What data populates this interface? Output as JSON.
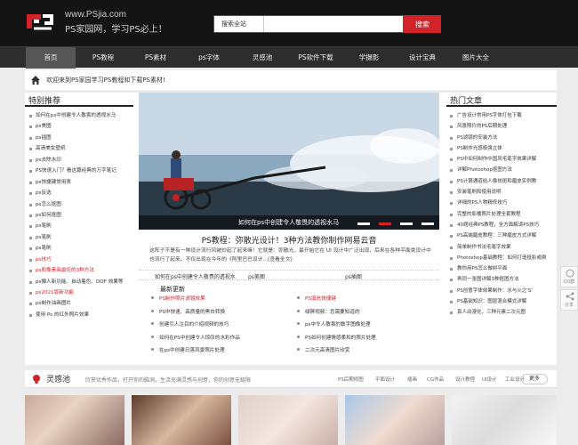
{
  "header": {
    "site_url": "www.PSjia.com",
    "slogan": "PS家园网，学习PS必上！",
    "search_select": "搜索全站",
    "search_value": "",
    "search_button": "搜索"
  },
  "nav": {
    "items": [
      "首页",
      "PS教程",
      "PS素材",
      "ps字体",
      "灵感池",
      "PS软件下载",
      "学摄影",
      "设计宝典",
      "图片大全"
    ],
    "active_index": 0
  },
  "welcome": "欢迎来到PS家园学习PS教程和下载PS素材!",
  "left": {
    "title": "特别推荐",
    "items": [
      {
        "text": "如何在ps中创建令人敬畏的透视水马"
      },
      {
        "text": "ps美图"
      },
      {
        "text": "ps插图"
      },
      {
        "text": "高清美女壁纸"
      },
      {
        "text": "ps去除水印"
      },
      {
        "text": "PS快速入门？看这篇经典的万字笔记"
      },
      {
        "text": "ps快捷键常用表"
      },
      {
        "text": "ps反选"
      },
      {
        "text": "ps怎么抠图"
      },
      {
        "text": "ps如何抠图"
      },
      {
        "text": "ps笔刷"
      },
      {
        "text": "ps笔刷"
      },
      {
        "text": "ps笔刷"
      },
      {
        "text": "ps技巧",
        "red": true
      },
      {
        "text": "ps和像素画最佳的3种方法",
        "red": true
      },
      {
        "text": "ps懒人新功能、自动着色、DOF 效果等"
      },
      {
        "text": "ps2021版新功能",
        "red": true
      },
      {
        "text": "ps制作油画图片"
      },
      {
        "text": "使用 Ps 的红外照片效果"
      }
    ]
  },
  "center": {
    "slide_caption": "如何在ps中创建令人敬畏的透视水马",
    "article_title": "PS教程：弥散光设计！3种方法教你制作网易云音",
    "article_summary": "这阵子不是有一种设计流行风被炒起了起来嘛！它就是：弥散光。最开始它在 UI 设计中广泛出现，后来在各种平面类设计中也流行了起来。不仅出现在今年的《阿里巴巴设计...(查看全文)",
    "links": [
      "如何在ps中创建令人敬畏的透视水",
      "ps美图",
      "ps插图"
    ],
    "latest_label": "最新更新",
    "latest": [
      {
        "text": "PS制作照片滤镜效果",
        "red": true
      },
      {
        "text": "PS填充快捷键",
        "red": true
      },
      {
        "text": "PS中快速、高质量的黑白转换"
      },
      {
        "text": "绿屏视频：您需要知道的"
      },
      {
        "text": "创建引人注目的介绍视频的技巧"
      },
      {
        "text": "ps中令人敬畏的数字图像处理"
      },
      {
        "text": "如何在PS中创建令人惊叹的水彩作品"
      },
      {
        "text": "PS如何创建情感柔和的照片处理"
      },
      {
        "text": "在ps中创建日落风景照片处理"
      },
      {
        "text": "二次元高清图片欣赏"
      }
    ]
  },
  "right": {
    "title": "热门文章",
    "items": [
      "广告设计常用PS字体打包下载",
      "风景照片的PS后期处理",
      "PS滤镜的安装方法",
      "PS制作光感极强立体",
      "PS中如何制作中国风毛笔字效果详解",
      "详解Photoshop抠图方法",
      "PS计算通道给人像祛斑和磨皮实例教",
      "安装笔刷和使用说明",
      "详细的PS人物精修技巧",
      "完整的影楼照片处理全套教程",
      "40题经典PS教程，全方面解读PS技巧",
      "PS高端磨皮教程：三种磨皮方式详解",
      "简单制作书法毛笔字效果",
      "Photoshop基础教程：如何打造投影或倒",
      "教你用PS怎么做树平面",
      "再同一张图详解3种抠图方法",
      "PS创意字体效果制作：水与火之'S'",
      "PS基础知识：图层混合模式详解",
      "真人动漫化，三种元素二次元图"
    ]
  },
  "side_tools": [
    "QQ群",
    "分享"
  ],
  "inspire": {
    "title": "灵感池",
    "desc": "欣赏优秀作品，打开你的脑洞，生活充满灵感与创意，你的创意无极限",
    "tags": [
      "PS后期修图",
      "平面设计",
      "插画",
      "CG作品",
      "设计教程",
      "UI设计",
      "工业设计"
    ],
    "more": "更多"
  },
  "colors": {
    "accent": "#d2232a",
    "header_bg": "#141414",
    "nav_bg": "#2d2d2d"
  }
}
